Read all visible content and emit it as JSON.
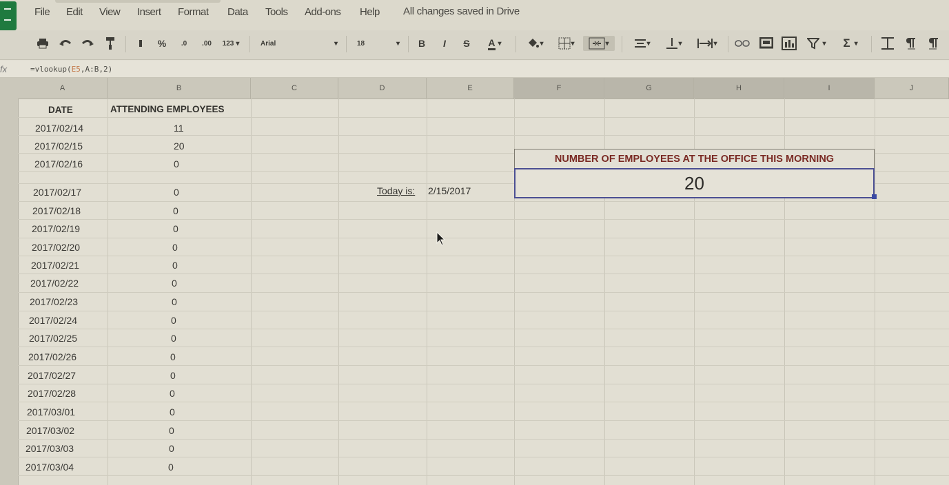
{
  "menu": {
    "items": [
      "File",
      "Edit",
      "View",
      "Insert",
      "Format",
      "Data",
      "Tools",
      "Add-ons",
      "Help"
    ],
    "save_status": "All changes saved in Drive"
  },
  "toolbar": {
    "percent": "%",
    "decimal_decrease": ".0",
    "decimal_increase": ".00",
    "more_formats": "123",
    "font": "Arial",
    "font_size": "18",
    "bold": "B",
    "italic": "I",
    "strikethrough": "S",
    "text_color": "A",
    "sum": "Σ"
  },
  "formula_bar": {
    "fx": "fx",
    "formula_prefix": "=vlookup(",
    "formula_ref": "E5",
    "formula_suffix": ",A:B,2)"
  },
  "columns": [
    "A",
    "B",
    "C",
    "D",
    "E",
    "F",
    "G",
    "H",
    "I",
    "J"
  ],
  "table": {
    "headers": [
      "DATE",
      "ATTENDING EMPLOYEES"
    ],
    "rows": [
      [
        "2017/02/14",
        "11"
      ],
      [
        "2017/02/15",
        "20"
      ],
      [
        "2017/02/16",
        "0"
      ],
      [
        "2017/02/17",
        "0"
      ],
      [
        "2017/02/18",
        "0"
      ],
      [
        "2017/02/19",
        "0"
      ],
      [
        "2017/02/20",
        "0"
      ],
      [
        "2017/02/21",
        "0"
      ],
      [
        "2017/02/22",
        "0"
      ],
      [
        "2017/02/23",
        "0"
      ],
      [
        "2017/02/24",
        "0"
      ],
      [
        "2017/02/25",
        "0"
      ],
      [
        "2017/02/26",
        "0"
      ],
      [
        "2017/02/27",
        "0"
      ],
      [
        "2017/02/28",
        "0"
      ],
      [
        "2017/03/01",
        "0"
      ],
      [
        "2017/03/02",
        "0"
      ],
      [
        "2017/03/03",
        "0"
      ],
      [
        "2017/03/04",
        "0"
      ]
    ]
  },
  "today": {
    "label": "Today is:",
    "value": "2/15/2017"
  },
  "summary": {
    "header": "NUMBER OF EMPLOYEES AT THE OFFICE THIS MORNING",
    "value": "20"
  },
  "colors": {
    "accent": "#4b4f93",
    "header_text": "#7a2a24",
    "brand_green": "#1f7a3f"
  }
}
